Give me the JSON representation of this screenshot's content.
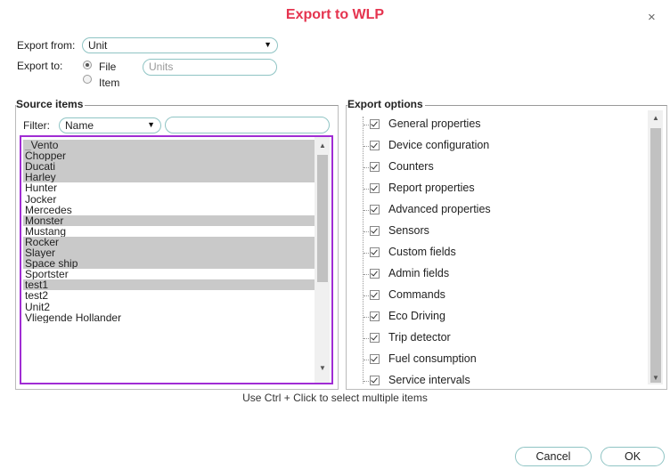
{
  "dialog": {
    "title": "Export to WLP",
    "close_glyph": "×"
  },
  "export_from": {
    "label": "Export from:",
    "value": "Unit"
  },
  "export_to": {
    "label": "Export to:",
    "file_label": "File",
    "item_label": "Item",
    "selected": "File",
    "name_placeholder": "Units"
  },
  "source": {
    "legend": "Source items",
    "filter_label": "Filter:",
    "filter_value": "Name",
    "filter_text": "",
    "items": [
      {
        "label": "_Vento",
        "selected": true
      },
      {
        "label": "Chopper",
        "selected": true
      },
      {
        "label": "Ducati",
        "selected": true
      },
      {
        "label": "Harley",
        "selected": true
      },
      {
        "label": "Hunter",
        "selected": false
      },
      {
        "label": "Jocker",
        "selected": false
      },
      {
        "label": "Mercedes",
        "selected": false
      },
      {
        "label": "Monster",
        "selected": true
      },
      {
        "label": "Mustang",
        "selected": false
      },
      {
        "label": "Rocker",
        "selected": true
      },
      {
        "label": "Slayer",
        "selected": true
      },
      {
        "label": "Space ship",
        "selected": true
      },
      {
        "label": "Sportster",
        "selected": false
      },
      {
        "label": "test1",
        "selected": true
      },
      {
        "label": "test2",
        "selected": false
      },
      {
        "label": "Unit2",
        "selected": false
      },
      {
        "label": "Vliegende Hollander",
        "selected": false
      }
    ]
  },
  "options": {
    "legend": "Export options",
    "items": [
      {
        "label": "General properties",
        "checked": true
      },
      {
        "label": "Device configuration",
        "checked": true
      },
      {
        "label": "Counters",
        "checked": true
      },
      {
        "label": "Report properties",
        "checked": true
      },
      {
        "label": "Advanced properties",
        "checked": true
      },
      {
        "label": "Sensors",
        "checked": true
      },
      {
        "label": "Custom fields",
        "checked": true
      },
      {
        "label": "Admin fields",
        "checked": true
      },
      {
        "label": "Commands",
        "checked": true
      },
      {
        "label": "Eco Driving",
        "checked": true
      },
      {
        "label": "Trip detector",
        "checked": true
      },
      {
        "label": "Fuel consumption",
        "checked": true
      },
      {
        "label": "Service intervals",
        "checked": true
      }
    ]
  },
  "hint": "Use Ctrl + Click to select multiple items",
  "buttons": {
    "cancel": "Cancel",
    "ok": "OK"
  },
  "icons": {
    "dropdown": "triangle-down-icon",
    "close": "close-icon",
    "checkbox": "checkmark-icon"
  },
  "colors": {
    "title": "#e5344f",
    "selection_outline": "#a02cd4",
    "pill_border": "#8fc4c4",
    "selected_row": "#c9c9c9"
  }
}
